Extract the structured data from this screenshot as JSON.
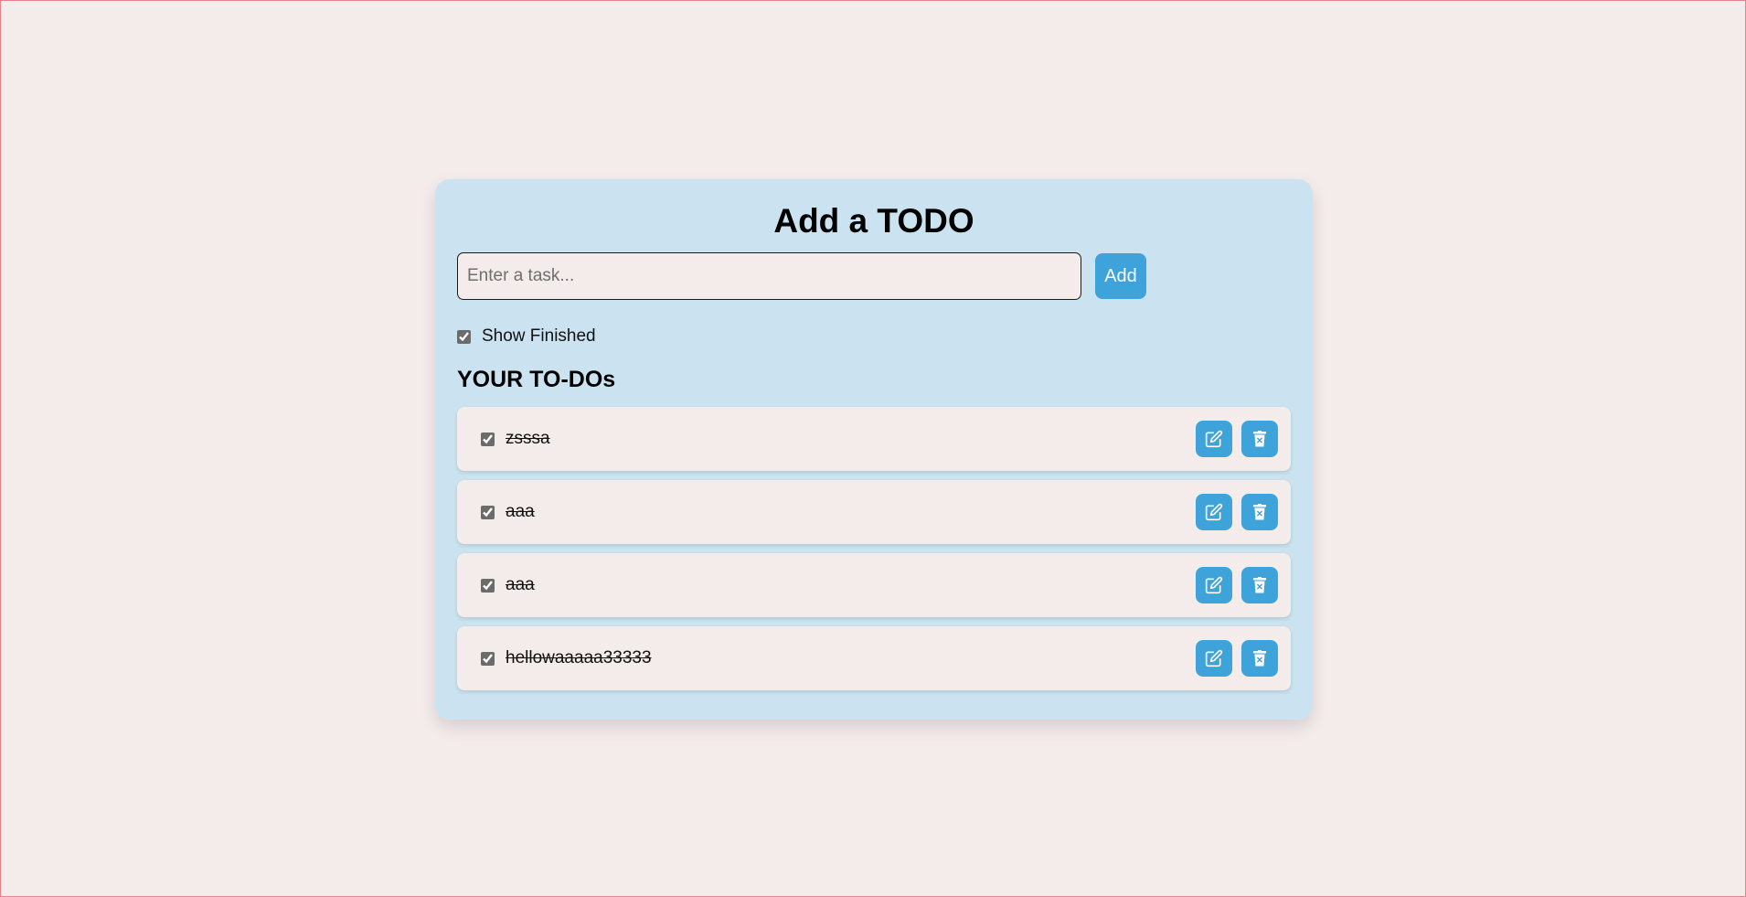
{
  "header": {
    "title": "Add a TODO"
  },
  "add_form": {
    "placeholder": "Enter a task...",
    "value": "",
    "add_label": "Add"
  },
  "filter": {
    "show_finished_label": "Show Finished",
    "show_finished_checked": true
  },
  "list": {
    "title": "YOUR TO-DOs",
    "items": [
      {
        "text": "zsssa",
        "done": true
      },
      {
        "text": "aaa",
        "done": true
      },
      {
        "text": "aaa",
        "done": true
      },
      {
        "text": "hellowaaaaa33333",
        "done": true
      }
    ]
  },
  "icons": {
    "edit": "edit-icon",
    "delete": "delete-icon"
  },
  "colors": {
    "page_background": "#f4ebeb",
    "card_background": "#cbe3f0",
    "accent": "#3ea2db"
  }
}
